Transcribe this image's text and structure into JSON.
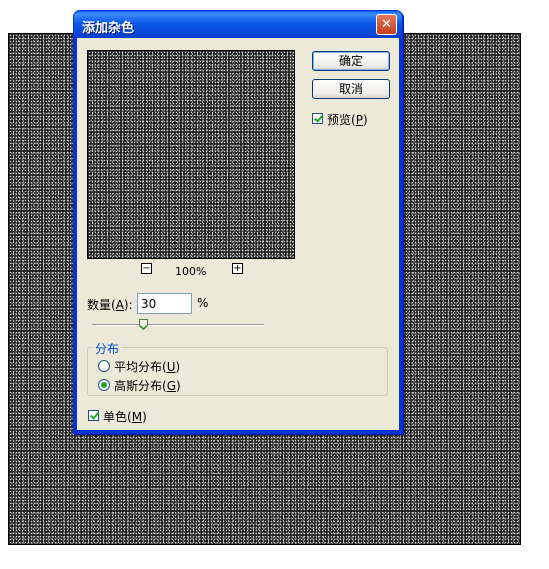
{
  "dialog": {
    "title": "添加杂色",
    "close_glyph": "✕",
    "ok_label": "确定",
    "cancel_label": "取消",
    "preview": {
      "label": "预览",
      "mnemonic": "P",
      "checked": true
    },
    "zoom": {
      "minus": "−",
      "plus": "+",
      "value": "100%"
    },
    "amount": {
      "label": "数量",
      "mnemonic": "A",
      "colon": ":",
      "value": "30",
      "unit": "%",
      "slider_fraction": 0.3
    },
    "distribution": {
      "title": "分布",
      "options": [
        {
          "label": "平均分布",
          "mnemonic": "U",
          "selected": false
        },
        {
          "label": "高斯分布",
          "mnemonic": "G",
          "selected": true
        }
      ]
    },
    "monochromatic": {
      "label": "单色",
      "mnemonic": "M",
      "checked": true
    }
  },
  "colors": {
    "title_bar": "#0a58e8",
    "dialog_face": "#ece9d8",
    "accent_group": "#0046d5"
  },
  "icons": {
    "close": "close-icon",
    "zoom_out": "zoom-out-icon",
    "zoom_in": "zoom-in-icon",
    "slider": "slider-thumb-icon"
  }
}
